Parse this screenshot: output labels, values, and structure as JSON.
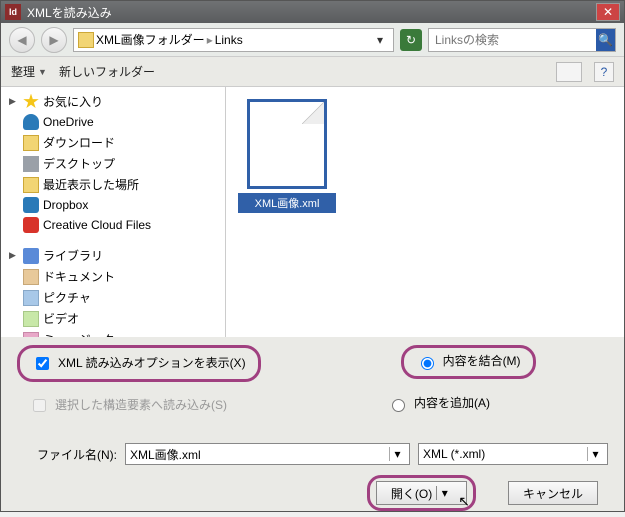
{
  "title": "XMLを読み込み",
  "breadcrumb": {
    "parts": [
      "XML画像フォルダー",
      "Links"
    ]
  },
  "search": {
    "placeholder": "Linksの検索"
  },
  "toolbar": {
    "organize": "整理",
    "newfolder": "新しいフォルダー"
  },
  "sidebar": {
    "fav": "お気に入り",
    "items_fav": [
      "OneDrive",
      "ダウンロード",
      "デスクトップ",
      "最近表示した場所",
      "Dropbox",
      "Creative Cloud Files"
    ],
    "lib": "ライブラリ",
    "items_lib": [
      "ドキュメント",
      "ピクチャ",
      "ビデオ",
      "ミュージック"
    ]
  },
  "file": {
    "name": "XML画像.xml"
  },
  "options": {
    "show_import_options": "XML 読み込みオプションを表示(X)",
    "read_into_selected": "選択した構造要素へ読み込み(S)",
    "merge_content": "内容を結合(M)",
    "append_content": "内容を追加(A)"
  },
  "filename_label": "ファイル名(N):",
  "filename_value": "XML画像.xml",
  "filter": "XML (*.xml)",
  "buttons": {
    "open": "開く(O)",
    "cancel": "キャンセル"
  }
}
